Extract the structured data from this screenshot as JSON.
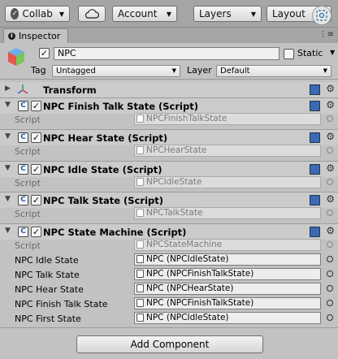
{
  "toolbar": {
    "collab_label": "Collab",
    "account_label": "Account",
    "layers_label": "Layers",
    "layout_label": "Layout"
  },
  "tab": {
    "label": "Inspector"
  },
  "gameobject": {
    "name": "NPC",
    "static_label": "Static",
    "tag_label": "Tag",
    "tag_value": "Untagged",
    "layer_label": "Layer",
    "layer_value": "Default"
  },
  "transform": {
    "title": "Transform"
  },
  "components": [
    {
      "title": "NPC Finish Talk State (Script)",
      "script_label": "Script",
      "script_value": "NPCFinishTalkState"
    },
    {
      "title": "NPC Hear State (Script)",
      "script_label": "Script",
      "script_value": "NPCHearState"
    },
    {
      "title": "NPC Idle State (Script)",
      "script_label": "Script",
      "script_value": "NPCIdleState"
    },
    {
      "title": "NPC Talk State (Script)",
      "script_label": "Script",
      "script_value": "NPCTalkState"
    },
    {
      "title": "NPC State Machine (Script)",
      "script_label": "Script",
      "script_value": "NPCStateMachine",
      "fields": [
        {
          "label": "NPC Idle State",
          "value": "NPC (NPCIdleState)"
        },
        {
          "label": "NPC Talk State",
          "value": "NPC (NPCFinishTalkState)"
        },
        {
          "label": "NPC Hear State",
          "value": "NPC (NPCHearState)"
        },
        {
          "label": "NPC Finish Talk State",
          "value": "NPC (NPCFinishTalkState)"
        },
        {
          "label": "NPC First State",
          "value": "NPC (NPCIdleState)"
        }
      ]
    }
  ],
  "add_component_label": "Add Component",
  "colors": {
    "panel": "#c2c2c2",
    "toolbar": "#a5a5a5",
    "help_book": "#3a6ab3"
  }
}
